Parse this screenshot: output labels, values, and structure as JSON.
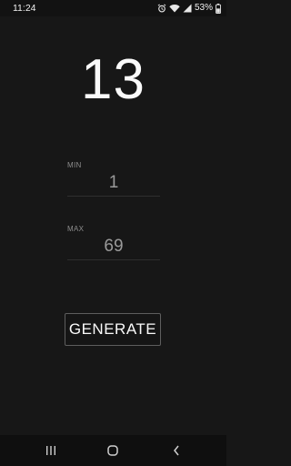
{
  "status_bar": {
    "time": "11:24",
    "battery_percent": "53%",
    "icons": [
      "alarm-icon",
      "wifi-icon",
      "signal-icon",
      "battery-icon"
    ]
  },
  "result": {
    "value": "13"
  },
  "min_field": {
    "label": "MIN",
    "value": "1"
  },
  "max_field": {
    "label": "MAX",
    "value": "69"
  },
  "generate_button": {
    "label": "GENERATE"
  },
  "nav_bar": {
    "icons": [
      "recents-icon",
      "home-icon",
      "back-icon"
    ]
  },
  "colors": {
    "background": "#171717",
    "text": "#fafafa",
    "muted": "#9a9a9a"
  }
}
